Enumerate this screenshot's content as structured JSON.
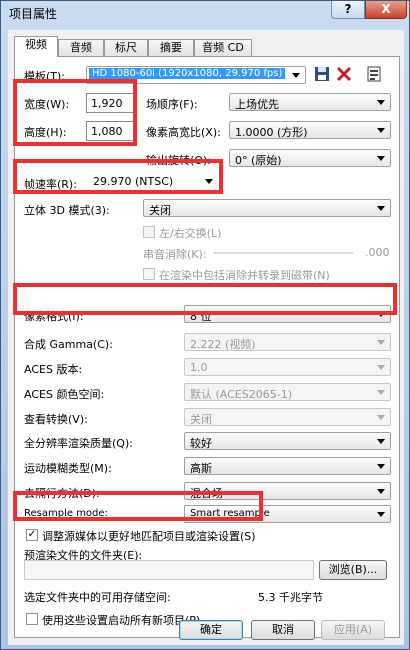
{
  "window": {
    "title": "项目属性",
    "help": "?",
    "close": "X"
  },
  "tabs": [
    "视频",
    "音频",
    "标尺",
    "摘要",
    "音频 CD"
  ],
  "template": {
    "label": "模板(T):",
    "value": "HD 1080-60i (1920x1080, 29.970 fps)"
  },
  "width": {
    "label": "宽度(W):",
    "value": "1,920"
  },
  "height": {
    "label": "高度(H):",
    "value": "1,080"
  },
  "field_order": {
    "label": "场顺序(F):",
    "value": "上场优先"
  },
  "pixel_aspect": {
    "label": "像素高宽比(X):",
    "value": "1.0000 (方形)"
  },
  "output_rotation": {
    "label": "输出旋转(O):",
    "value": "0°  (原始)"
  },
  "frame_rate": {
    "label": "帧速率(R):",
    "value": "29.970 (NTSC)"
  },
  "stereo3d": {
    "label": "立体 3D 模式(3):",
    "value": "关闭"
  },
  "swap_lr": {
    "label": "左/右交换(L)"
  },
  "crosstalk": {
    "label": "串音消除(K):",
    "value": ".000"
  },
  "include_overlaps": {
    "label": "在渲染中包括消除并转录到磁带(N)"
  },
  "pixel_format": {
    "label": "像素格式(I):",
    "value": "8 位"
  },
  "gamma": {
    "label": "合成 Gamma(C):",
    "value": "2.222 (视频)"
  },
  "aces_version": {
    "label": "ACES 版本:",
    "value": "1.0"
  },
  "aces_colorspace": {
    "label": "ACES 颜色空间:",
    "value": "默认 (ACES2065-1)"
  },
  "view_transform": {
    "label": "查看转换(V):",
    "value": "关闭"
  },
  "render_quality": {
    "label": "全分辨率渲染质量(Q):",
    "value": "较好"
  },
  "motion_blur": {
    "label": "运动模糊类型(M):",
    "value": "高斯"
  },
  "deinterlace": {
    "label": "去隔行方法(D):",
    "value": "混合场"
  },
  "resample": {
    "label": "Resample mode:",
    "value": "Smart resample"
  },
  "adjust_media": {
    "label": "调整源媒体以更好地匹配项目或渲染设置(S)",
    "checked": "✓"
  },
  "prerender": {
    "label": "预渲染文件的文件夹(E):",
    "browse": "浏览(B)..."
  },
  "free_space": {
    "label": "选定文件夹中的可用存储空间:",
    "value": "5.3 千兆字节"
  },
  "use_for_new": {
    "label": "使用这些设置启动所有新项目(P)"
  },
  "buttons": {
    "ok": "确定",
    "cancel": "取消",
    "apply": "应用(A)"
  },
  "colors": {
    "highlight_box": "#f03030",
    "selection": "#3399ff"
  }
}
